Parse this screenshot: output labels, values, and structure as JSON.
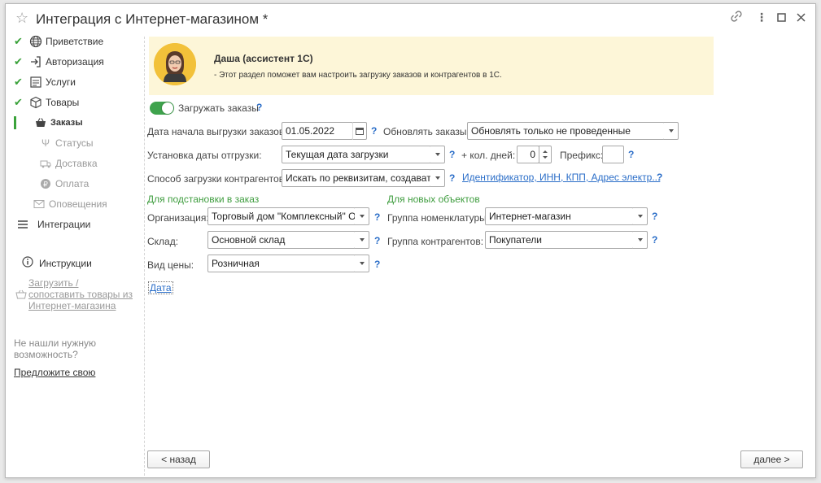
{
  "window": {
    "title": "Интеграция с Интернет-магазином *"
  },
  "sidebar": {
    "items": [
      {
        "label": "Приветствие",
        "done": true,
        "icon": "globe-icon"
      },
      {
        "label": "Авторизация",
        "done": true,
        "icon": "login-icon"
      },
      {
        "label": "Услуги",
        "done": true,
        "icon": "services-icon"
      },
      {
        "label": "Товары",
        "done": true,
        "icon": "box-icon"
      },
      {
        "label": "Заказы",
        "active": true,
        "icon": "basket-icon"
      },
      {
        "label": "Статусы",
        "icon": "status-icon"
      },
      {
        "label": "Доставка",
        "icon": "truck-icon"
      },
      {
        "label": "Оплата",
        "icon": "coin-icon"
      },
      {
        "label": "Оповещения",
        "icon": "envelope-icon"
      },
      {
        "label": "Интеграции",
        "icon": "list-icon"
      }
    ],
    "instructions_label": "Инструкции",
    "upload_link_line1": "Загрузить /",
    "upload_link_line2": "сопоставить товары из",
    "upload_link_line3": "Интернет-магазина",
    "not_found_line1": "Не нашли нужную",
    "not_found_line2": "возможность?",
    "suggest_link": "Предложите свою"
  },
  "assistant": {
    "name": "Даша (ассистент 1С)",
    "text": "- Этот раздел поможет вам настроить загрузку заказов и контрагентов в 1С."
  },
  "form": {
    "load_orders_label": "Загружать заказы",
    "load_orders_on": true,
    "start_date_label": "Дата начала выгрузки заказов:",
    "start_date_value": "01.05.2022",
    "update_orders_label": "Обновлять заказы:",
    "update_orders_value": "Обновлять только не проведенные",
    "ship_date_label": "Установка даты отгрузки:",
    "ship_date_value": "Текущая дата загрузки",
    "plus_days_label": "+ кол. дней:",
    "plus_days_value": "0",
    "prefix_label": "Префикс:",
    "prefix_value": "",
    "counterparty_method_label": "Способ загрузки контрагентов:",
    "counterparty_method_value": "Искать по реквизитам, создавать,",
    "identifier_link": "Идентификатор, ИНН, КПП, Адрес электр...",
    "section_substitution": "Для подстановки в заказ",
    "section_new_objects": "Для новых объектов",
    "organization_label": "Организация:",
    "organization_value": "Торговый дом \"Комплексный\" ООО",
    "warehouse_label": "Склад:",
    "warehouse_value": "Основной склад",
    "price_type_label": "Вид цены:",
    "price_type_value": "Розничная",
    "nomenclature_group_label": "Группа номенклатуры:",
    "nomenclature_group_value": "Интернет-магазин",
    "counterparty_group_label": "Группа контрагентов:",
    "counterparty_group_value": "Покупатели",
    "date_link": "Дата",
    "help": "?"
  },
  "nav": {
    "back_label": "< назад",
    "next_label": "далее >"
  },
  "colors": {
    "accent_green": "#3aa23a",
    "link_blue": "#2b6ec8",
    "assistant_bg": "#fdf6d8"
  }
}
